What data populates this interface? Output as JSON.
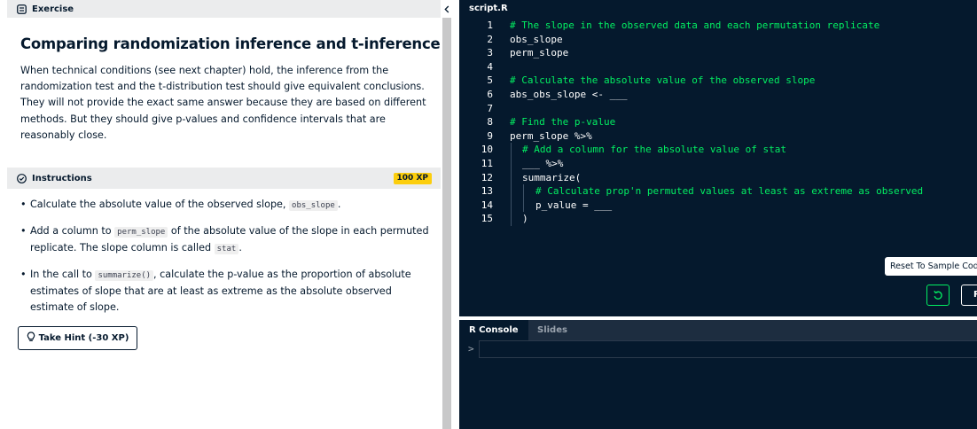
{
  "exercise_header": {
    "label": "Exercise"
  },
  "exercise": {
    "title": "Comparing randomization inference and t-inference",
    "description": "When technical conditions (see next chapter) hold, the inference from the randomization test and the t-distribution test should give equivalent conclusions. They will not provide the exact same answer because they are based on different methods. But they should give p-values and confidence intervals that are reasonably close."
  },
  "instructions": {
    "label": "Instructions",
    "xp": "100 XP",
    "items": [
      {
        "before": "Calculate the absolute value of the observed slope, ",
        "code": "obs_slope",
        "after": "."
      },
      {
        "before": "Add a column to ",
        "code": "perm_slope",
        "mid": " of the absolute value of the slope in each permuted replicate. The slope column is called ",
        "code2": "stat",
        "after": "."
      },
      {
        "before": "In the call to ",
        "code": "summarize()",
        "after": ", calculate the p-value as the proportion of absolute estimates of slope that are at least as extreme as the absolute observed estimate of slope."
      }
    ],
    "hint_button": "Take Hint (-30 XP)"
  },
  "editor": {
    "file_tab": "script.R",
    "lines": [
      {
        "n": "1",
        "text": "# The slope in the observed data and each permutation replicate",
        "comment": true,
        "level": 0
      },
      {
        "n": "2",
        "text": "obs_slope",
        "comment": false,
        "level": 0
      },
      {
        "n": "3",
        "text": "perm_slope",
        "comment": false,
        "level": 0
      },
      {
        "n": "4",
        "text": "",
        "comment": false,
        "level": 0
      },
      {
        "n": "5",
        "text": "# Calculate the absolute value of the observed slope",
        "comment": true,
        "level": 0
      },
      {
        "n": "6",
        "text": "abs_obs_slope <- ___",
        "comment": false,
        "level": 0
      },
      {
        "n": "7",
        "text": "",
        "comment": false,
        "level": 0
      },
      {
        "n": "8",
        "text": "# Find the p-value",
        "comment": true,
        "level": 0
      },
      {
        "n": "9",
        "text": "perm_slope %>%",
        "comment": false,
        "level": 0
      },
      {
        "n": "10",
        "text": "# Add a column for the absolute value of stat",
        "comment": true,
        "level": 1
      },
      {
        "n": "11",
        "text": "___ %>%",
        "comment": false,
        "level": 1
      },
      {
        "n": "12",
        "text": "summarize(",
        "comment": false,
        "level": 1
      },
      {
        "n": "13",
        "text": "# Calculate prop'n permuted values at least as extreme as observed",
        "comment": true,
        "level": 2
      },
      {
        "n": "14",
        "text": "p_value = ___",
        "comment": false,
        "level": 2
      },
      {
        "n": "15",
        "text": ")",
        "comment": false,
        "level": 1
      }
    ],
    "reset_tooltip": "Reset To Sample Code",
    "run_label": "Run"
  },
  "console": {
    "tabs": [
      "R Console",
      "Slides"
    ],
    "prompt": ">"
  },
  "colors": {
    "navy": "#05192d",
    "green": "#03ef62",
    "xp_yellow": "#fcce0d",
    "header_gray": "#ebeced"
  }
}
